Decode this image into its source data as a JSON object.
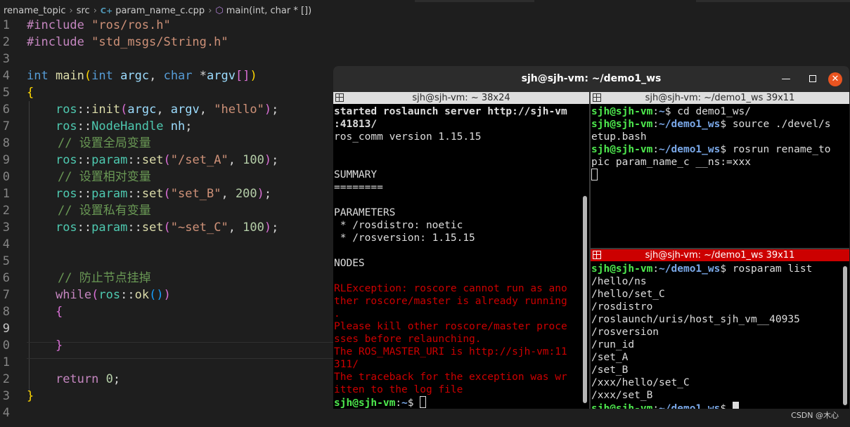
{
  "breadcrumb": {
    "folder": "rename_topic",
    "subfolder": "src",
    "file": "param_name_c.cpp",
    "symbol": "main(int, char * [])"
  },
  "editor": {
    "line_numbers": [
      "1",
      "2",
      "3",
      "4",
      "5",
      "6",
      "7",
      "8",
      "9",
      "0",
      "1",
      "2",
      "3",
      "4",
      "5",
      "6",
      "7",
      "8",
      "9",
      "0",
      "1",
      "2",
      "3",
      "4"
    ],
    "comment_global": "// 设置全局变量",
    "comment_relative": "// 设置相对变量",
    "comment_private": "// 设置私有变量",
    "comment_block": "// 防止节点挂掉",
    "str_ros": "\"ros/ros.h\"",
    "str_std": "\"std_msgs/String.h\"",
    "str_hello": "\"hello\"",
    "str_set_a": "\"/set_A\"",
    "str_set_b": "\"set_B\"",
    "str_set_c": "\"~set_C\"",
    "num_100": "100",
    "num_200": "200",
    "num_0": "0"
  },
  "terminal": {
    "title": "sjh@sjh-vm: ~/demo1_ws",
    "pane_left_title": "sjh@sjh-vm: ~ 38x24",
    "pane_tr_title": "sjh@sjh-vm: ~/demo1_ws 39x11",
    "pane_br_title": "sjh@sjh-vm: ~/demo1_ws 39x11",
    "user_host": "sjh@sjh-vm",
    "path_home": "~",
    "path_ws": "~/demo1_ws",
    "left_lines": {
      "l1": "started roslaunch server http://sjh-vm",
      "l2": ":41813/",
      "l3": "ros_comm version 1.15.15",
      "l4": "SUMMARY",
      "l5": "========",
      "l6": "PARAMETERS",
      "l7": " * /rosdistro: noetic",
      "l8": " * /rosversion: 1.15.15",
      "l9": "NODES",
      "e1": "RLException: roscore cannot run as ano",
      "e2": "ther roscore/master is already running",
      "e3": ".",
      "e4": "Please kill other roscore/master proce",
      "e5": "sses before relaunching.",
      "e6": "The ROS_MASTER_URI is http://sjh-vm:11",
      "e7": "311/",
      "e8": "The traceback for the exception was wr",
      "e9": "itten to the log file"
    },
    "tr_cmd1": "cd demo1_ws/",
    "tr_cmd2a": "source ./devel/s",
    "tr_cmd2b": "etup.bash",
    "tr_cmd3a": "rosrun rename_to",
    "tr_cmd3b": "pic param_name_c __ns:=xxx",
    "br_cmd": "rosparam list",
    "br_params": [
      "/hello/ns",
      "/hello/set_C",
      "/rosdistro",
      "/roslaunch/uris/host_sjh_vm__40935",
      "/rosversion",
      "/run_id",
      "/set_A",
      "/set_B",
      "/xxx/hello/set_C",
      "/xxx/set_B"
    ]
  },
  "watermark": "CSDN @木心",
  "colors": {
    "editor_bg": "#1e1e1e",
    "terminal_bg": "#000000",
    "active_pane": "#cc0000",
    "prompt_green": "#4ee94e",
    "path_blue": "#7aa8e8",
    "error_red": "#cc0000",
    "close_orange": "#e95420"
  }
}
